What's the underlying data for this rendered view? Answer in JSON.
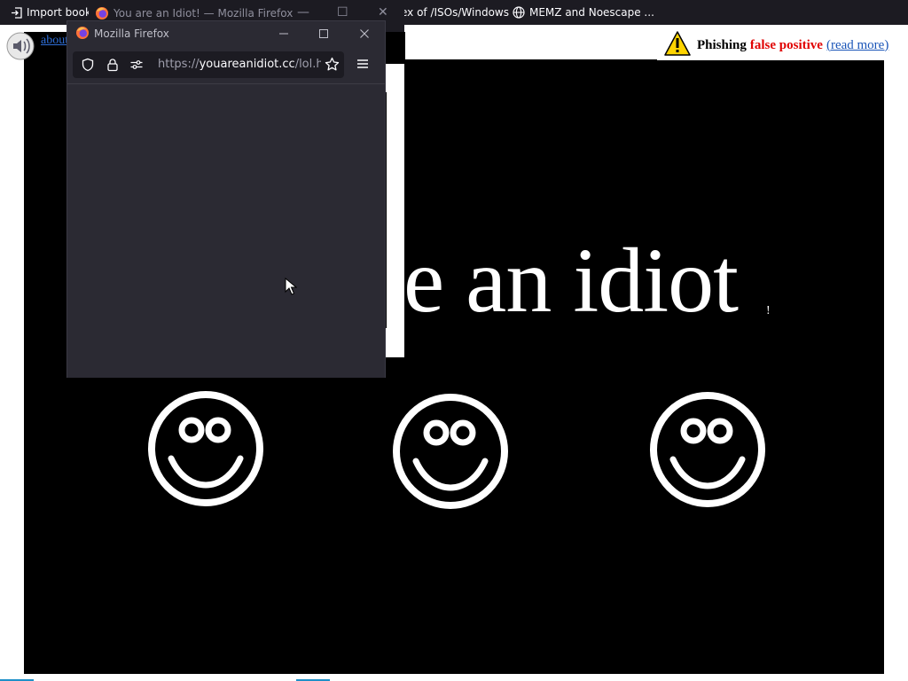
{
  "bookmarks": [
    {
      "label": "Import book"
    },
    {
      "label": "ex of /ISOs/Windows"
    },
    {
      "label": "MEMZ and Noescape ..."
    }
  ],
  "background_window": {
    "title": "You are an Idiot! — Mozilla Firefox",
    "control_minimize": "—",
    "control_maximize": "☐",
    "control_close": "✕"
  },
  "page": {
    "about_link": "about",
    "phishing_banner": {
      "label": "Phishing",
      "highlight": "false positive",
      "link": "(read more)"
    },
    "headline": "e an idiot",
    "headline_suffix": "!",
    "smiley_count": 3
  },
  "popup": {
    "title": "Mozilla Firefox",
    "url": {
      "protocol": "https://",
      "host": "youareanidiot.cc",
      "path": "/lol.htm"
    }
  },
  "colors": {
    "browser_chrome": "#1c1b22",
    "popup_bg": "#2b2a33",
    "warning_red": "#e00000",
    "link_blue": "#1a55b8"
  }
}
